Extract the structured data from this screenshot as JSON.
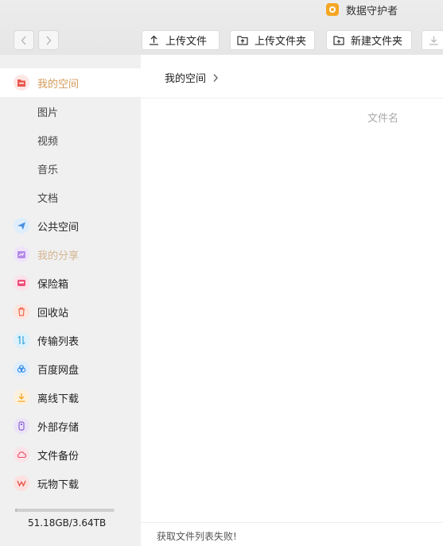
{
  "app": {
    "title": "数据守护者"
  },
  "toolbar": {
    "upload_file": "上传文件",
    "upload_folder": "上传文件夹",
    "new_folder": "新建文件夹"
  },
  "sidebar": {
    "items": [
      {
        "label": "我的空间",
        "icon": "my-space-icon",
        "color": "#e8574d"
      },
      {
        "label": "图片"
      },
      {
        "label": "视频"
      },
      {
        "label": "音乐"
      },
      {
        "label": "文档"
      },
      {
        "label": "公共空间",
        "icon": "send-icon",
        "color": "#4a90e2"
      },
      {
        "label": "我的分享",
        "icon": "share-icon",
        "color": "#a66ee0"
      },
      {
        "label": "保险箱",
        "icon": "safe-icon",
        "color": "#ec4f7a"
      },
      {
        "label": "回收站",
        "icon": "trash-icon",
        "color": "#f06a4e"
      },
      {
        "label": "传输列表",
        "icon": "transfer-icon",
        "color": "#3fa9d9"
      },
      {
        "label": "百度网盘",
        "icon": "cloud-icon",
        "color": "#3a8ee6"
      },
      {
        "label": "离线下载",
        "icon": "download-icon",
        "color": "#f5a623"
      },
      {
        "label": "外部存储",
        "icon": "usb-icon",
        "color": "#8a63d2"
      },
      {
        "label": "文件备份",
        "icon": "backup-icon",
        "color": "#e94e6b"
      },
      {
        "label": "玩物下载",
        "icon": "wanwu-icon",
        "color": "#e8574d"
      }
    ],
    "storage": {
      "used_text": "51.18GB/3.64TB",
      "fraction": 0.014
    }
  },
  "main": {
    "breadcrumb": "我的空间",
    "column_header": "文件名",
    "status": "获取文件列表失败!"
  }
}
